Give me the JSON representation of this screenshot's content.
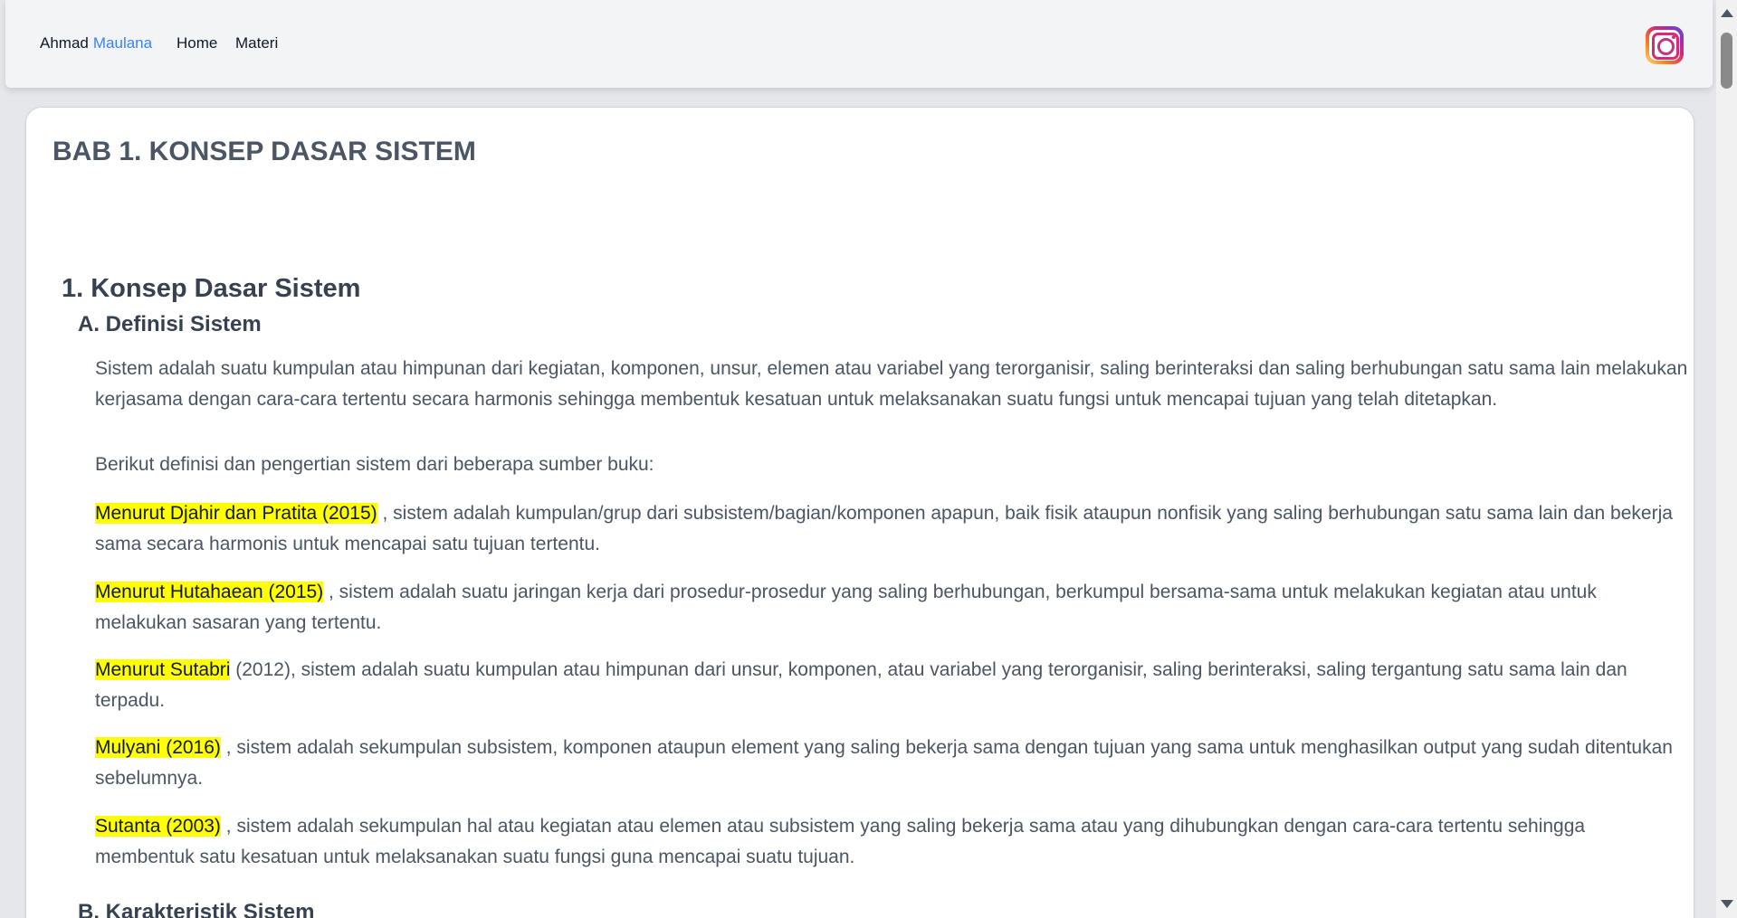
{
  "nav": {
    "brand_first": "Ahmad",
    "brand_last": "Maulana",
    "links": [
      "Home",
      "Materi"
    ],
    "instagram_icon": "instagram-icon"
  },
  "content": {
    "page_title": "BAB 1. KONSEP DASAR SISTEM",
    "section_title": "1. Konsep Dasar Sistem",
    "subsection_a": "A. Definisi Sistem",
    "definition": "Sistem adalah suatu kumpulan atau himpunan dari kegiatan, komponen, unsur, elemen atau variabel yang terorganisir, saling berinteraksi dan saling berhubungan satu sama lain melakukan kerjasama dengan cara-cara tertentu secara harmonis sehingga membentuk kesatuan untuk melaksanakan suatu fungsi untuk mencapai tujuan yang telah ditetapkan.",
    "intro": "Berikut definisi dan pengertian sistem dari beberapa sumber buku:",
    "definitions": [
      {
        "source": "Menurut Djahir dan Pratita (2015)",
        "text": " , sistem adalah kumpulan/grup dari subsistem/bagian/komponen apapun, baik fisik ataupun nonfisik yang saling berhubungan satu sama lain dan bekerja sama secara harmonis untuk mencapai satu tujuan tertentu."
      },
      {
        "source": "Menurut Hutahaean (2015)",
        "text": " , sistem adalah suatu jaringan kerja dari prosedur-prosedur yang saling berhubungan, berkumpul bersama-sama untuk melakukan kegiatan atau untuk melakukan sasaran yang tertentu."
      },
      {
        "source": "Menurut Sutabri",
        "text": " (2012), sistem adalah suatu kumpulan atau himpunan dari unsur, komponen, atau variabel yang terorganisir, saling berinteraksi, saling tergantung satu sama lain dan terpadu."
      },
      {
        "source": "Mulyani (2016)",
        "text": " , sistem adalah sekumpulan subsistem, komponen ataupun element yang saling bekerja sama dengan tujuan yang sama untuk menghasilkan output yang sudah ditentukan sebelumnya."
      },
      {
        "source": "Sutanta (2003)",
        "text": " , sistem adalah sekumpulan hal atau kegiatan atau elemen atau subsistem yang saling bekerja sama atau yang dihubungkan dengan cara-cara tertentu sehingga membentuk satu kesatuan untuk melaksanakan suatu fungsi guna mencapai suatu tujuan."
      }
    ],
    "subsection_b": "B. Karakteristik Sistem"
  },
  "colors": {
    "highlight": "#ffff00",
    "brand_accent": "#3b82f6"
  }
}
